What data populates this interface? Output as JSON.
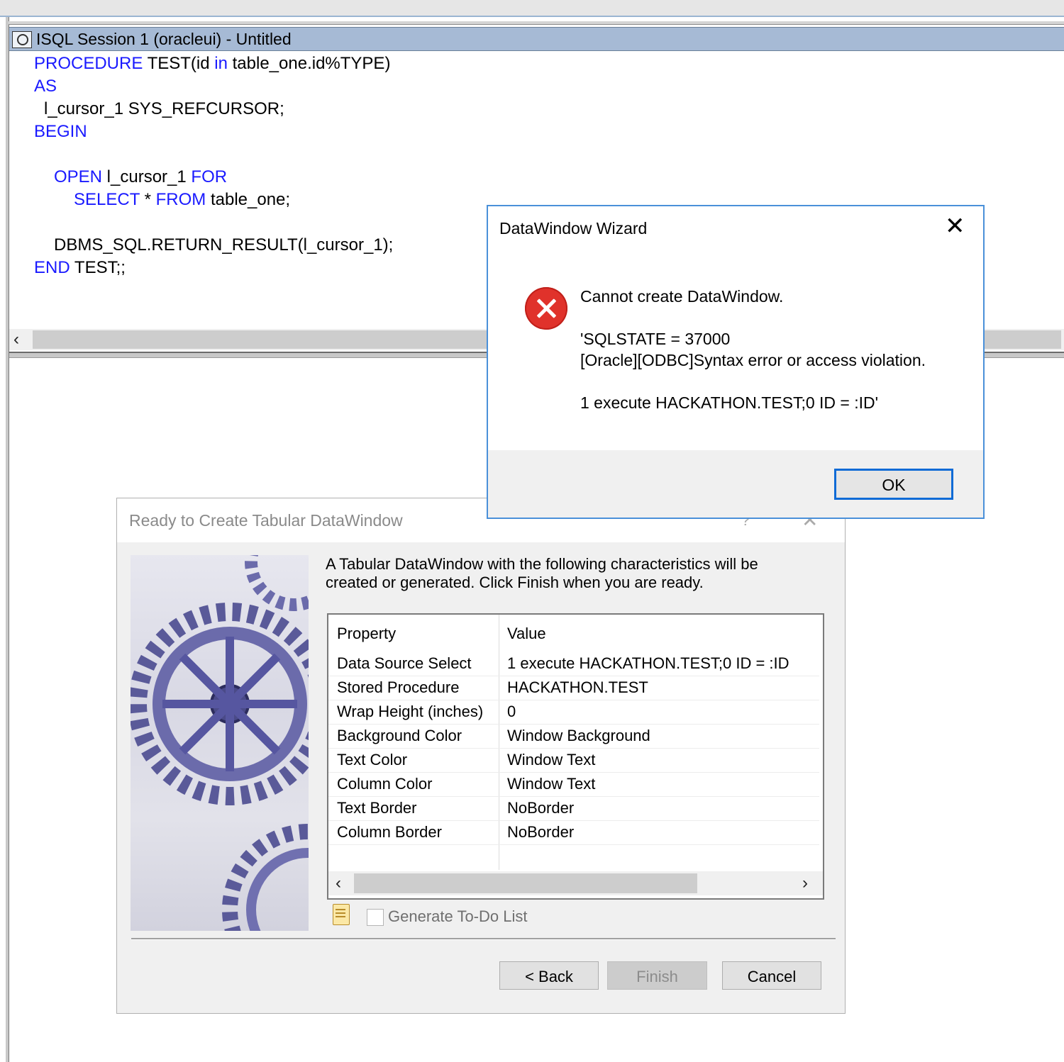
{
  "isql": {
    "title": "ISQL Session 1 (oracleui) - Untitled",
    "code": [
      {
        "indent": 2,
        "parts": [
          {
            "t": "PROCEDURE",
            "k": true
          },
          {
            "t": " TEST(id ",
            "k": false
          },
          {
            "t": "in",
            "k": true
          },
          {
            "t": " table_one.id%TYPE)",
            "k": false
          }
        ]
      },
      {
        "indent": 2,
        "parts": [
          {
            "t": "AS",
            "k": true
          }
        ]
      },
      {
        "indent": 3,
        "parts": [
          {
            "t": "l_cursor_1 SYS_REFCURSOR;",
            "k": false
          }
        ]
      },
      {
        "indent": 2,
        "parts": [
          {
            "t": "BEGIN",
            "k": true
          }
        ]
      },
      {
        "indent": 0,
        "parts": []
      },
      {
        "indent": 4,
        "parts": [
          {
            "t": "OPEN",
            "k": true
          },
          {
            "t": " l_cursor_1 ",
            "k": false
          },
          {
            "t": "FOR",
            "k": true
          }
        ]
      },
      {
        "indent": 6,
        "parts": [
          {
            "t": "SELECT",
            "k": true
          },
          {
            "t": " * ",
            "k": false
          },
          {
            "t": "FROM",
            "k": true
          },
          {
            "t": " table_one;",
            "k": false
          }
        ]
      },
      {
        "indent": 0,
        "parts": []
      },
      {
        "indent": 4,
        "parts": [
          {
            "t": "DBMS_SQL.RETURN_RESULT(l_cursor_1);",
            "k": false
          }
        ]
      },
      {
        "indent": 2,
        "parts": [
          {
            "t": "END",
            "k": true
          },
          {
            "t": " TEST;;",
            "k": false
          }
        ]
      }
    ]
  },
  "wizard": {
    "title": "Ready to Create Tabular DataWindow",
    "help_glyph": "?",
    "close_glyph": "✕",
    "description_line1": "A Tabular DataWindow with the following characteristics will be",
    "description_line2": "created or generated.  Click Finish when you are ready.",
    "table": {
      "headers": [
        "Property",
        "Value"
      ],
      "rows": [
        [
          "Data Source Select",
          "1 execute HACKATHON.TEST;0 ID = :ID"
        ],
        [
          "Stored Procedure",
          "HACKATHON.TEST"
        ],
        [
          "Wrap Height (inches)",
          "0"
        ],
        [
          "Background Color",
          "Window Background"
        ],
        [
          "Text Color",
          "Window Text"
        ],
        [
          "Column Color",
          "Window Text"
        ],
        [
          "Text Border",
          "NoBorder"
        ],
        [
          "Column Border",
          "NoBorder"
        ]
      ]
    },
    "todo_label": "Generate To-Do List",
    "buttons": {
      "back": "< Back",
      "finish": "Finish",
      "cancel": "Cancel"
    }
  },
  "msgbox": {
    "title": "DataWindow Wizard",
    "close_glyph": "✕",
    "line1": "Cannot create DataWindow.",
    "line2": "'SQLSTATE = 37000",
    "line3": "[Oracle][ODBC]Syntax error or access violation.",
    "line4": "1 execute HACKATHON.TEST;0 ID = :ID'",
    "ok": "OK"
  },
  "colors": {
    "keyword": "#1a1aff",
    "title_bar": "#a6bad5",
    "dialog_border": "#4a90d9",
    "error": "#e0322b"
  }
}
